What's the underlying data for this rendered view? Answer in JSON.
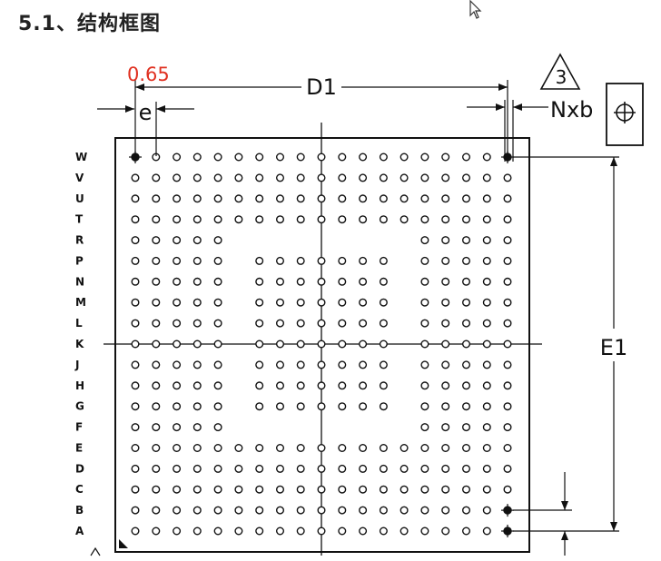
{
  "heading": "5.1、结构框图",
  "diagram": {
    "pitch_label": "0.65",
    "d1_label": "D1",
    "e_label": "e",
    "e1_label": "E1",
    "nxb_label": "Nxb",
    "note_number": "3",
    "row_labels": [
      "W",
      "V",
      "U",
      "T",
      "R",
      "P",
      "N",
      "M",
      "L",
      "K",
      "J",
      "H",
      "G",
      "F",
      "E",
      "D",
      "C",
      "B",
      "A"
    ],
    "columns": 19,
    "colors": {
      "pitch_label": "#e03020",
      "lines": "#111111"
    }
  }
}
